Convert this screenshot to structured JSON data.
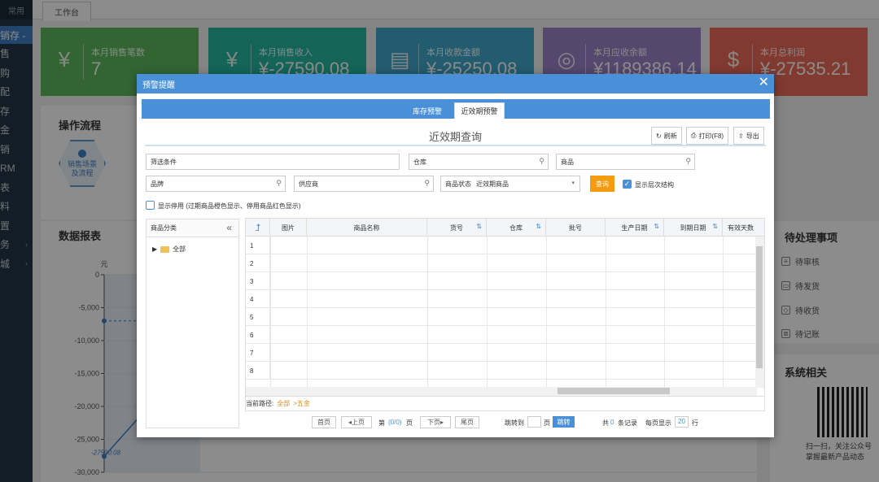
{
  "nav": {
    "top_label": "常用",
    "active_label": "销存",
    "items": [
      "售",
      "购",
      "配",
      "存",
      "金",
      "销",
      "RM",
      "表",
      "料",
      "置",
      "务",
      "城"
    ]
  },
  "tabs": {
    "work": "工作台"
  },
  "cards": [
    {
      "label": "本月销售笔数",
      "value": "7",
      "color": "#5cb85c",
      "icon": "yen-icon"
    },
    {
      "label": "本月销售收入",
      "value": "¥-27590.08",
      "color": "#26b6a0",
      "icon": "calendar-yen-icon"
    },
    {
      "label": "本月收款金额",
      "value": "¥-25250.08",
      "color": "#3ea8c9",
      "icon": "clipboard-icon"
    },
    {
      "label": "本月应收余额",
      "value": "¥1189386.14",
      "color": "#9b82c7",
      "icon": "coins-icon"
    },
    {
      "label": "本月总利润",
      "value": "¥-27535.21",
      "color": "#e96a57",
      "icon": "money-bag-icon"
    }
  ],
  "ops": {
    "title": "操作流程",
    "hex_label_1": "销售场景",
    "hex_label_2": "及流程"
  },
  "report": {
    "title": "数据报表"
  },
  "chart_data": {
    "type": "line",
    "ylabel": "元",
    "yticks": [
      "0",
      "-5,000",
      "-10,000",
      "-15,000",
      "-20,000",
      "-25,000",
      "-30,000"
    ],
    "ylim": [
      -30000,
      0
    ],
    "point_label": "-27590.08"
  },
  "todo": {
    "title": "待处理事项",
    "items": [
      "待审核",
      "待发货",
      "待收货",
      "待记账"
    ]
  },
  "sys": {
    "title": "系统相关",
    "caption1": "扫一扫，关注公众号",
    "caption2": "掌握最新产品动态"
  },
  "dialog": {
    "title": "预警提醒",
    "close": "✕",
    "tab_stock": "库存预警",
    "tab_expiry": "近效期预警",
    "query_title": "近效期查询",
    "btn_refresh": "刷新",
    "btn_print": "打印(F8)",
    "btn_export": "导出",
    "filter_placeholder": "筛选条件",
    "warehouse_placeholder": "仓库",
    "goods_placeholder": "商品",
    "brand_placeholder": "品牌",
    "supplier_placeholder": "供应商",
    "status_label": "商品状态",
    "status_value": "近效期商品",
    "query_btn": "查询",
    "show_hierarchy": "显示层次结构",
    "show_disabled": "显示停用 (过期商品橙色显示、停用商品红色显示)",
    "category_header": "商品分类",
    "tree_root": "全部",
    "columns": [
      "图片",
      "商品名称",
      "货号",
      "仓库",
      "批号",
      "生产日期",
      "到期日期",
      "有效天数"
    ],
    "rows": [
      "1",
      "2",
      "3",
      "4",
      "5",
      "6",
      "7",
      "8"
    ],
    "path_label": "当前路径:",
    "path_root": "全部",
    "path_child": ">五金",
    "pager": {
      "first": "首页",
      "prev": "上页",
      "page_prefix": "第",
      "page_value": "(0/0)",
      "page_suffix": "页",
      "next": "下页",
      "last": "尾页",
      "jump_label": "跳转到",
      "jump_suffix": "页",
      "go": "跳转",
      "total_prefix": "共",
      "total_value": "0",
      "total_suffix": "条记录",
      "per_page_label": "每页显示",
      "per_page_value": "20",
      "per_page_suffix": "行"
    }
  }
}
